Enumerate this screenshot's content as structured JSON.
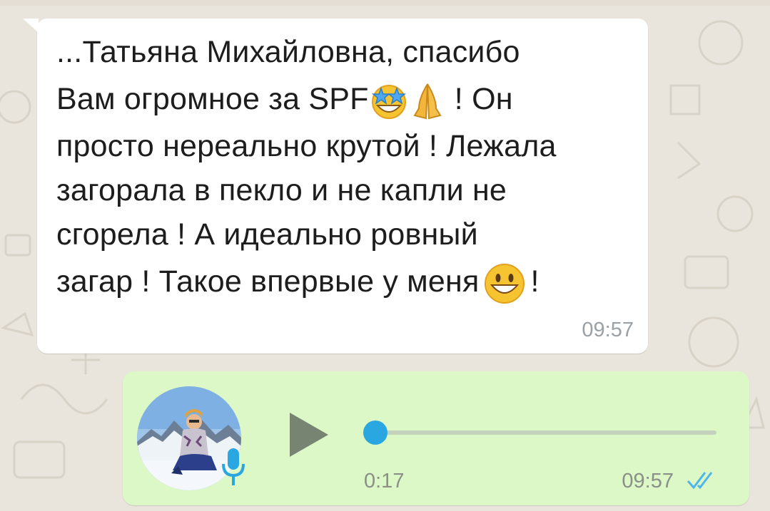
{
  "incoming_message": {
    "lines": [
      "...Татьяна Михайловна, спасибо",
      "Вам огромное за SPF",
      " ! Он",
      "просто нереально крутой ! Лежала",
      "загорала в пекло и не капли не",
      "сгорела ! А идеально ровный",
      "загар ! Такое впервые у меня",
      "!"
    ],
    "time": "09:57",
    "emojis": [
      "star-struck-emoji",
      "folded-hands-emoji",
      "grinning-face-emoji"
    ]
  },
  "voice_message": {
    "duration": "0:17",
    "time": "09:57",
    "progress": 0,
    "status": "read",
    "icons": [
      "avatar",
      "microphone-icon",
      "play-icon",
      "double-check-icon"
    ]
  },
  "colors": {
    "incoming_bubble": "#ffffff",
    "outgoing_bubble": "#dcf8c6",
    "progress_knob": "#2aa7e0",
    "mic": "#2aa7e0",
    "read_ticks": "#4fb6ec",
    "chat_background": "#e9e4dc"
  }
}
